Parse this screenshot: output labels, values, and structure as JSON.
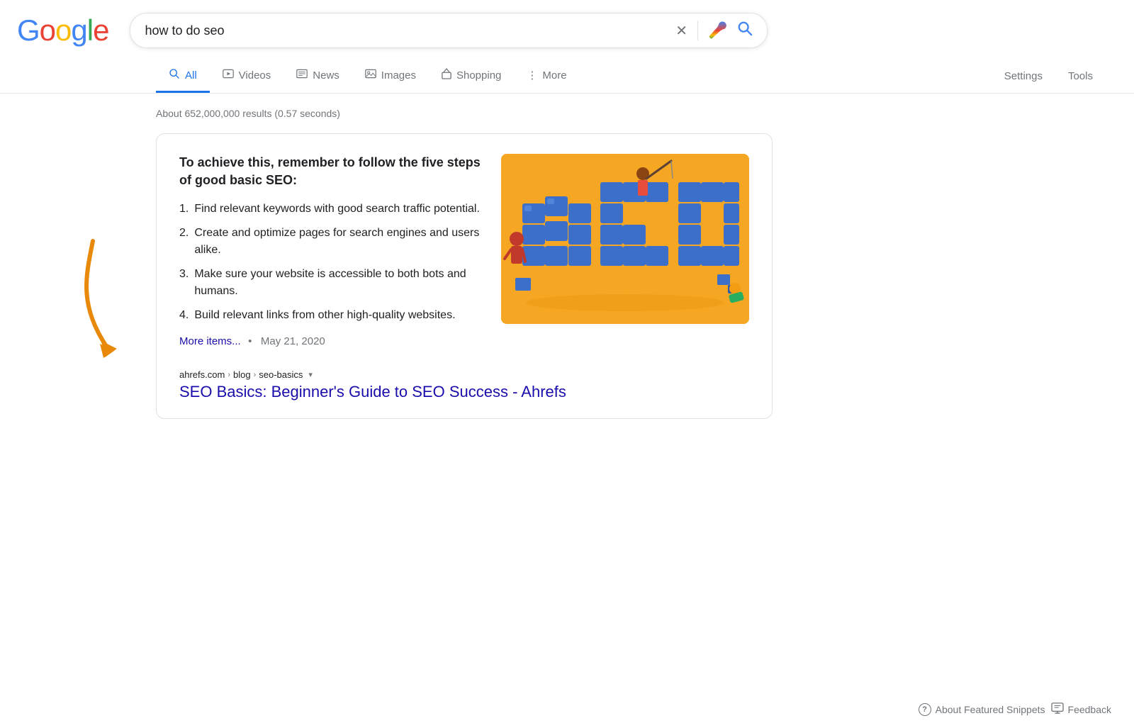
{
  "header": {
    "logo": {
      "g": "G",
      "o1": "o",
      "o2": "o",
      "g2": "g",
      "l": "l",
      "e": "e"
    },
    "search_query": "how to do seo",
    "clear_icon": "×",
    "mic_icon": "🎤",
    "search_icon": "🔍"
  },
  "nav": {
    "tabs": [
      {
        "id": "all",
        "label": "All",
        "icon": "🔍",
        "active": true
      },
      {
        "id": "videos",
        "label": "Videos",
        "icon": "▶"
      },
      {
        "id": "news",
        "label": "News",
        "icon": "📰"
      },
      {
        "id": "images",
        "label": "Images",
        "icon": "🖼"
      },
      {
        "id": "shopping",
        "label": "Shopping",
        "icon": "◇"
      },
      {
        "id": "more",
        "label": "More",
        "icon": "⋮"
      }
    ],
    "settings_label": "Settings",
    "tools_label": "Tools"
  },
  "results": {
    "count_text": "About 652,000,000 results (0.57 seconds)",
    "featured_snippet": {
      "title": "To achieve this, remember to follow the five steps of good basic SEO:",
      "list_items": [
        {
          "number": "1.",
          "text": "Find relevant keywords with good search traffic potential."
        },
        {
          "number": "2.",
          "text": "Create and optimize pages for search engines and users alike."
        },
        {
          "number": "3.",
          "text": "Make sure your website is accessible to both bots and humans."
        },
        {
          "number": "4.",
          "text": "Build relevant links from other high-quality websites."
        }
      ],
      "more_link": "More items...",
      "date": "May 21, 2020",
      "breadcrumb": {
        "domain": "ahrefs.com",
        "path1": "blog",
        "path2": "seo-basics"
      },
      "result_title": "SEO Basics: Beginner's Guide to SEO Success - Ahrefs"
    }
  },
  "footer": {
    "about_snippets": "About Featured Snippets",
    "feedback": "Feedback"
  }
}
